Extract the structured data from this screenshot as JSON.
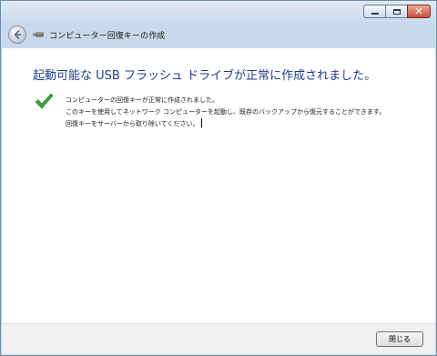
{
  "window": {
    "minimize_icon": "minimize-icon",
    "maximize_icon": "maximize-icon",
    "close_icon": "close-icon"
  },
  "navbar": {
    "back_icon": "back-arrow-icon",
    "app_icon": "usb-drive-icon",
    "title": "コンピューター回復キーの作成"
  },
  "main": {
    "heading": "起動可能な USB フラッシュ ドライブが正常に作成されました。",
    "status_icon": "checkmark-icon",
    "message_lines": [
      "コンピューターの回復キーが正常に作成されました。",
      "このキーを使用してネットワーク コンピューターを起動し、既存のバックアップから復元することができます。",
      "回復キーをサーバーから取り除いてください。"
    ]
  },
  "footer": {
    "close_label": "閉じる"
  },
  "colors": {
    "heading": "#1e3d8f",
    "check": "#3aa43a",
    "close_caption": "#c74f3a"
  }
}
